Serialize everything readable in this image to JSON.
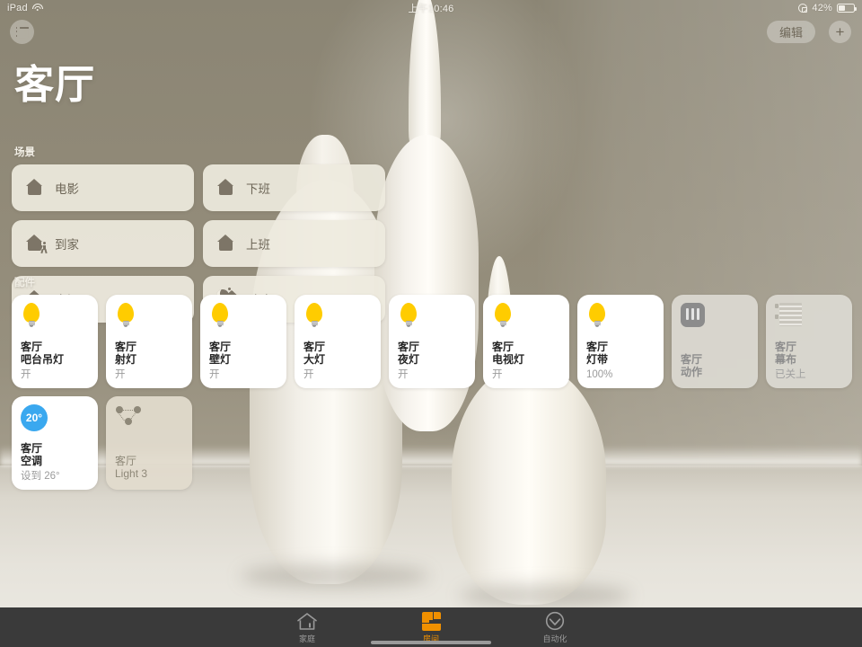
{
  "statusbar": {
    "device": "iPad",
    "wifi_icon": "wifi-icon",
    "time": "上午10:46",
    "orientation_lock_icon": "rotation-lock-icon",
    "battery_percent": "42%",
    "battery_icon": "battery-icon"
  },
  "navbar": {
    "menu_icon": "list-sidebar-icon",
    "edit_label": "编辑",
    "add_label": "+",
    "add_icon": "plus-icon"
  },
  "page": {
    "title": "客厅"
  },
  "scenes": {
    "section_label": "场景",
    "items": [
      {
        "label": "电影",
        "icon": "house-icon"
      },
      {
        "label": "下班",
        "icon": "house-icon"
      },
      {
        "label": "到家",
        "icon": "house-person-arrive-icon"
      },
      {
        "label": "上班",
        "icon": "house-icon"
      },
      {
        "label": "出门",
        "icon": "house-person-leave-icon"
      },
      {
        "label": "晚安",
        "icon": "moon-house-icon"
      }
    ]
  },
  "accessories": {
    "section_label": "配件",
    "items": [
      {
        "room": "客厅",
        "name": "吧台吊灯",
        "state": "开",
        "icon": "lightbulb-icon",
        "status": "on"
      },
      {
        "room": "客厅",
        "name": "射灯",
        "state": "开",
        "icon": "lightbulb-icon",
        "status": "on"
      },
      {
        "room": "客厅",
        "name": "壁灯",
        "state": "开",
        "icon": "lightbulb-icon",
        "status": "on"
      },
      {
        "room": "客厅",
        "name": "大灯",
        "state": "开",
        "icon": "lightbulb-icon",
        "status": "on"
      },
      {
        "room": "客厅",
        "name": "夜灯",
        "state": "开",
        "icon": "lightbulb-icon",
        "status": "on"
      },
      {
        "room": "客厅",
        "name": "电视灯",
        "state": "开",
        "icon": "lightbulb-icon",
        "status": "on"
      },
      {
        "room": "客厅",
        "name": "灯带",
        "state": "100%",
        "icon": "lightbulb-icon",
        "status": "on"
      },
      {
        "room": "客厅",
        "name": "动作",
        "state": "",
        "icon": "motion-sensor-icon",
        "status": "off"
      },
      {
        "room": "客厅",
        "name": "幕布",
        "state": "已关上",
        "icon": "blinds-icon",
        "status": "off"
      },
      {
        "room": "客厅",
        "name": "空调",
        "state": "设到 26°",
        "icon": "thermostat-icon",
        "status": "on",
        "temp": "20°"
      },
      {
        "room": "客厅",
        "name": "Light 3",
        "state": "",
        "icon": "mesh-bridge-icon",
        "status": "unavailable"
      }
    ]
  },
  "tabbar": {
    "tabs": [
      {
        "label": "家庭",
        "icon": "home-icon",
        "active": false
      },
      {
        "label": "房间",
        "icon": "rooms-icon",
        "active": true
      },
      {
        "label": "自动化",
        "icon": "automation-icon",
        "active": false
      }
    ]
  },
  "colors": {
    "accent": "#f09000",
    "bulb_on": "#ffcc00",
    "thermostat": "#3aa8ef",
    "card_on": "#ffffff",
    "card_off": "#dbd9d2",
    "tabbar": "#3a3a3a"
  }
}
